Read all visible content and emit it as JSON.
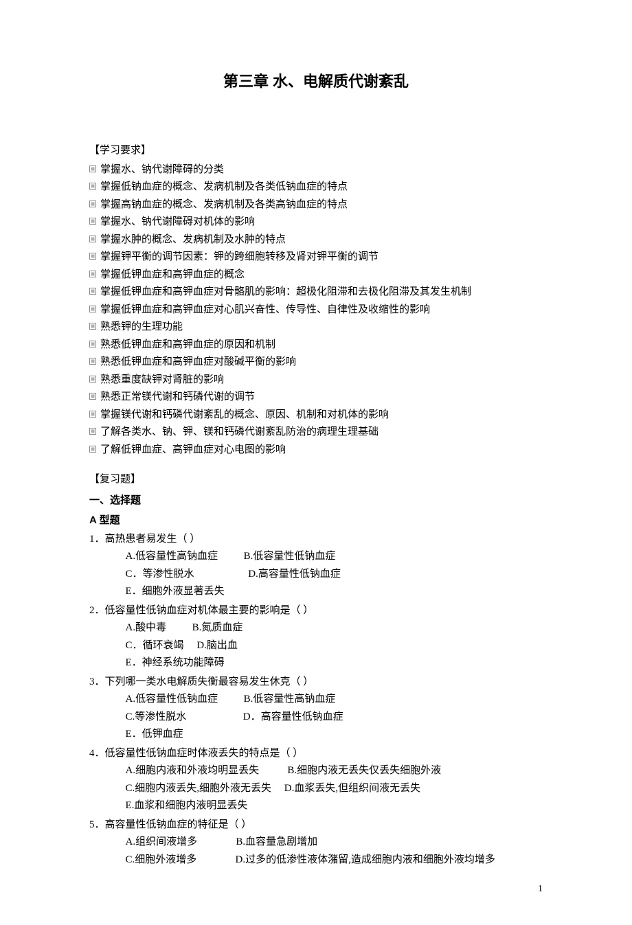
{
  "title": "第三章 水、电解质代谢紊乱",
  "sections": {
    "study_head": "【学习要求】",
    "review_head": "【复习题】",
    "part1": "一、选择题",
    "typeA": "A 型题"
  },
  "bullets": [
    "掌握水、钠代谢障碍的分类",
    "掌握低钠血症的概念、发病机制及各类低钠血症的特点",
    "掌握高钠血症的概念、发病机制及各类高钠血症的特点",
    "掌握水、钠代谢障碍对机体的影响",
    "掌握水肿的概念、发病机制及水肿的特点",
    "掌握钾平衡的调节因素：钾的跨细胞转移及肾对钾平衡的调节",
    "掌握低钾血症和高钾血症的概念",
    "掌握低钾血症和高钾血症对骨骼肌的影响：超极化阻滞和去极化阻滞及其发生机制",
    "掌握低钾血症和高钾血症对心肌兴奋性、传导性、自律性及收缩性的影响",
    "熟悉钾的生理功能",
    "熟悉低钾血症和高钾血症的原因和机制",
    "熟悉低钾血症和高钾血症对酸碱平衡的影响",
    "熟悉重度缺钾对肾脏的影响",
    "熟悉正常镁代谢和钙磷代谢的调节",
    "掌握镁代谢和钙磷代谢紊乱的概念、原因、机制和对机体的影响",
    "了解各类水、钠、钾、镁和钙磷代谢紊乱防治的病理生理基础",
    "了解低钾血症、高钾血症对心电图的影响"
  ],
  "questions": [
    {
      "stem": "1．高热患者易发生（ ）",
      "opts": [
        "A.低容量性高钠血症          B.低容量性低钠血症",
        "C．等渗性脱水                     D.高容量性低钠血症",
        "E．细胞外液显著丢失"
      ]
    },
    {
      "stem": "2．低容量性低钠血症对机体最主要的影响是（ ）",
      "opts": [
        "A.酸中毒          B.氮质血症",
        "C．循环衰竭     D.脑出血",
        "E．神经系统功能障碍"
      ]
    },
    {
      "stem": "3．下列哪一类水电解质失衡最容易发生休克（ ）",
      "opts": [
        "A.低容量性低钠血症          B.低容量性高钠血症",
        "C.等渗性脱水                      D．高容量性低钠血症",
        "E．低钾血症"
      ]
    },
    {
      "stem": "4．低容量性低钠血症时体液丢失的特点是（ ）",
      "opts": [
        "A.细胞内液和外液均明显丢失           B.细胞内液无丢失仅丢失细胞外液",
        "C.细胞内液丢失,细胞外液无丢失     D.血浆丢失,但组织间液无丢失",
        "E.血浆和细胞内液明显丢失"
      ]
    },
    {
      "stem": "5．高容量性低钠血症的特征是（ ）",
      "opts": [
        "A.组织间液增多               B.血容量急剧增加",
        "C.细胞外液增多               D.过多的低渗性液体潴留,造成细胞内液和细胞外液均增多"
      ]
    }
  ],
  "page_number": "1"
}
